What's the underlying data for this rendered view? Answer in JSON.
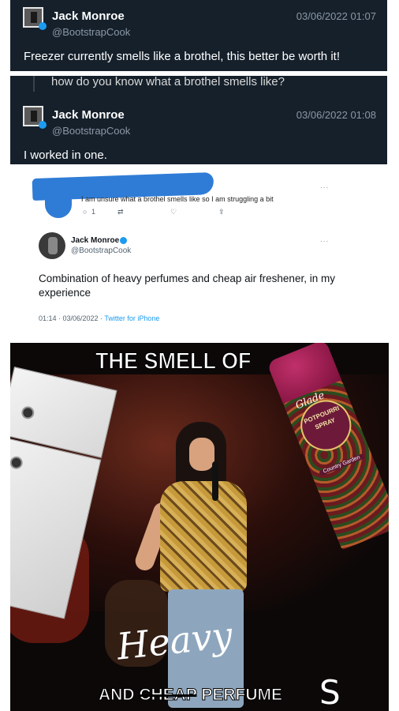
{
  "tweet1": {
    "name": "Jack Monroe",
    "handle": "@BootstrapCook",
    "timestamp": "03/06/2022 01:07",
    "text": "Freezer currently smells like a brothel, this better be worth it!"
  },
  "tweet2": {
    "quoted_reply": "how do you know what a brothel smells like?",
    "name": "Jack Monroe",
    "handle": "@BootstrapCook",
    "timestamp": "03/06/2022 01:08",
    "text": "I worked in one."
  },
  "tweet3": {
    "reply_text": "I am unsure what a brothel smells like so I am struggling a bit",
    "reply_count": "1",
    "more_label": "...",
    "name": "Jack Monroe",
    "handle": "@BootstrapCook",
    "text": "Combination of heavy perfumes and cheap air freshener, in my experience",
    "time_date": "01:14 · 03/06/2022 · ",
    "source": "Twitter for iPhone"
  },
  "meme": {
    "top_caption": "THE SMELL OF",
    "handwritten": "Heavy",
    "bottom_and": "AND ",
    "bottom_struck": "CHEAP",
    "bottom_rest": " PERFUME",
    "bottom_s": "S",
    "can_brand": "Glade",
    "can_label_1": "POTPOURRI",
    "can_label_2": "SPRAY",
    "can_variant": "Country Garden"
  }
}
